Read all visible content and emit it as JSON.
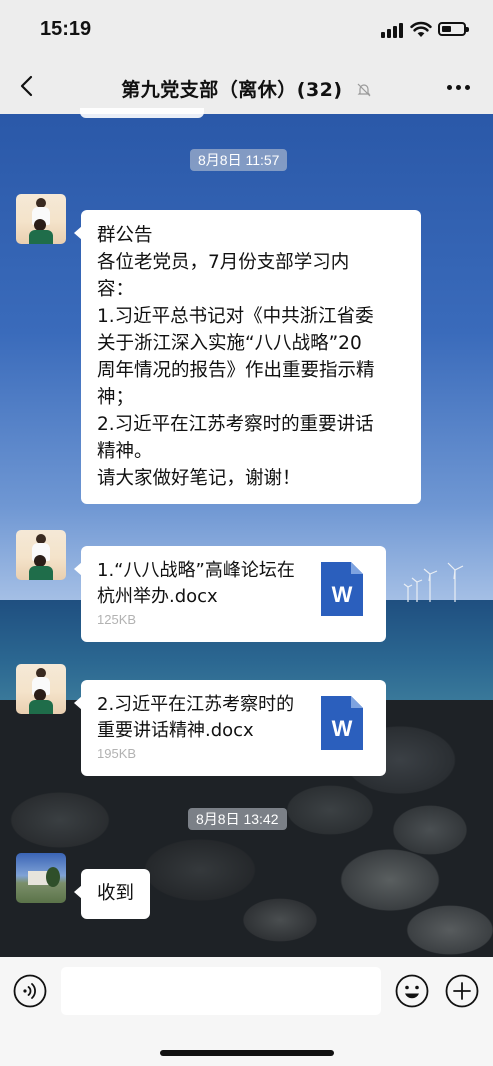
{
  "status_bar": {
    "time": "15:19",
    "icons": [
      "cellular-signal-icon",
      "wifi-icon",
      "battery-icon"
    ]
  },
  "nav": {
    "title": "第九党支部（离休）(32)",
    "back_icon": "chevron-left-icon",
    "mute_icon": "bell-off-icon",
    "more_icon": "more-dots-icon"
  },
  "messages": [
    {
      "kind": "timestamp",
      "text": "8月8日 11:57"
    },
    {
      "kind": "notice",
      "sender_avatar": "avatar-children-photo",
      "text": "群公告\n各位老党员，7月份支部学习内\n容：\n1.习近平总书记对《中共浙江省委\n关于浙江深入实施“八八战略”20\n周年情况的报告》作出重要指示精\n神；\n2.习近平在江苏考察时的重要讲话\n精神。\n请大家做好笔记，谢谢！"
    },
    {
      "kind": "file",
      "sender_avatar": "avatar-children-photo",
      "file_name": "1.“八八战略”高峰论坛在杭州举办.docx",
      "file_size": "125KB",
      "file_icon": "word-document-icon",
      "icon_letter": "W"
    },
    {
      "kind": "file",
      "sender_avatar": "avatar-children-photo",
      "file_name": "2.习近平在江苏考察时的重要讲话精神.docx",
      "file_size": "195KB",
      "file_icon": "word-document-icon",
      "icon_letter": "W"
    },
    {
      "kind": "timestamp",
      "text": "8月8日 13:42"
    },
    {
      "kind": "text",
      "sender_avatar": "avatar-landscape-photo",
      "text": "收到"
    }
  ],
  "input_bar": {
    "voice_icon": "voice-input-icon",
    "message_value": "",
    "emoji_icon": "emoji-icon",
    "plus_icon": "plus-circle-icon"
  },
  "colors": {
    "bar_bg": "#ededed",
    "bubble_bg": "#ffffff",
    "word_blue": "#2b5fbd",
    "timestamp_bg": "rgba(200,205,215,0.55)"
  }
}
